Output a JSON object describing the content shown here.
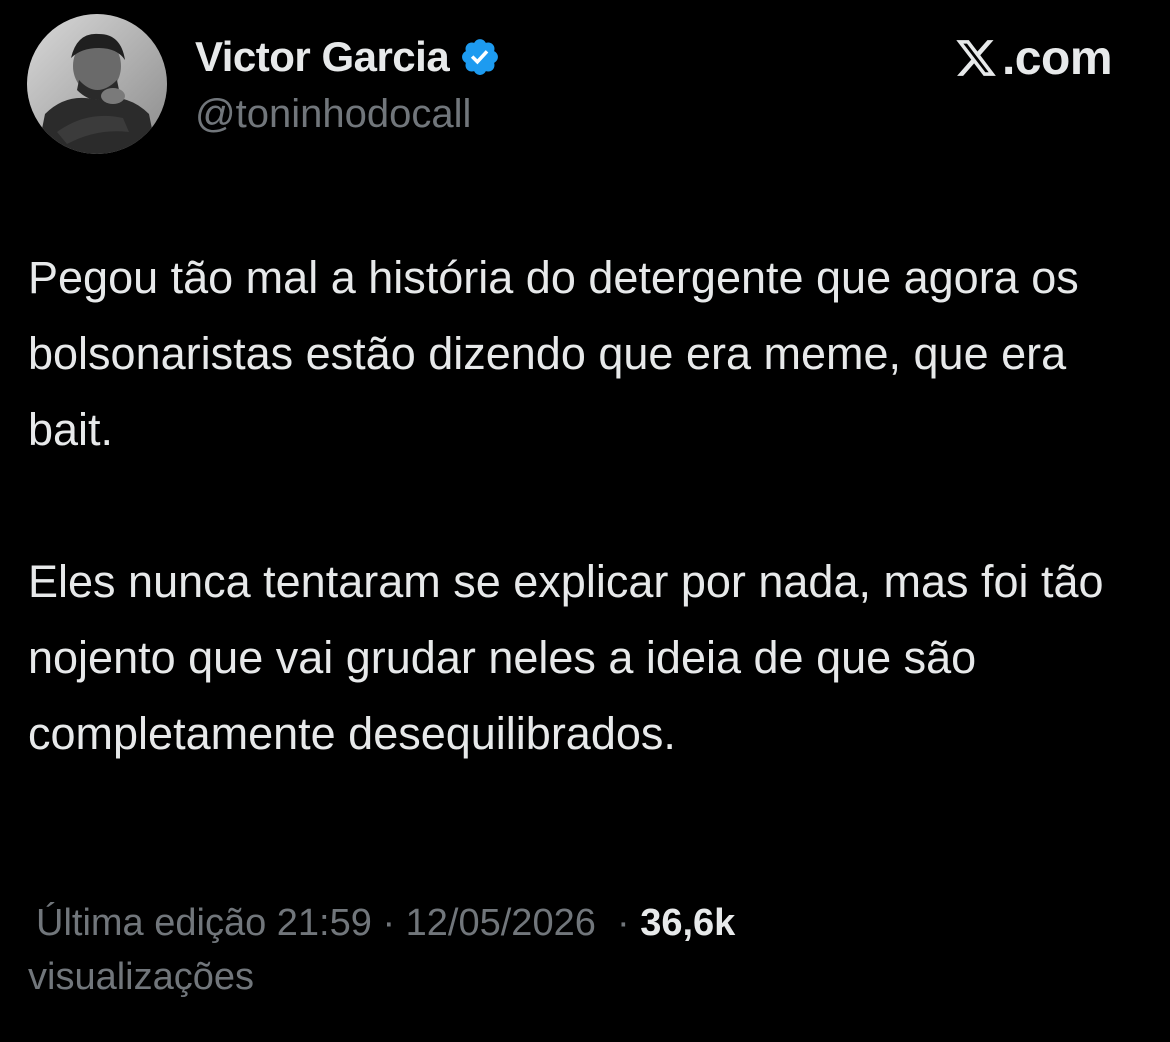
{
  "author": {
    "name": "Victor Garcia",
    "handle": "@toninhodocall",
    "verified": true,
    "verified_color": "#1d9bf0"
  },
  "brand": {
    "icon": "x-logo-icon",
    "suffix": ".com"
  },
  "tweet": {
    "paragraph_1": "Pegou tão mal a história do detergente que agora os bolsonaristas estão dizendo que era meme, que era bait.",
    "paragraph_2": "Eles nunca tentaram se explicar por nada, mas foi tão nojento que vai grudar neles a ideia de que são completamente desequilibrados."
  },
  "meta": {
    "edited_label": "Última edição",
    "time": "21:59",
    "separator": "·",
    "date": "12/05/2026",
    "views_count": "36,6k",
    "views_label": "visualizações"
  },
  "colors": {
    "background": "#000000",
    "primary_text": "#e7e9ea",
    "secondary_text": "#71767b"
  }
}
